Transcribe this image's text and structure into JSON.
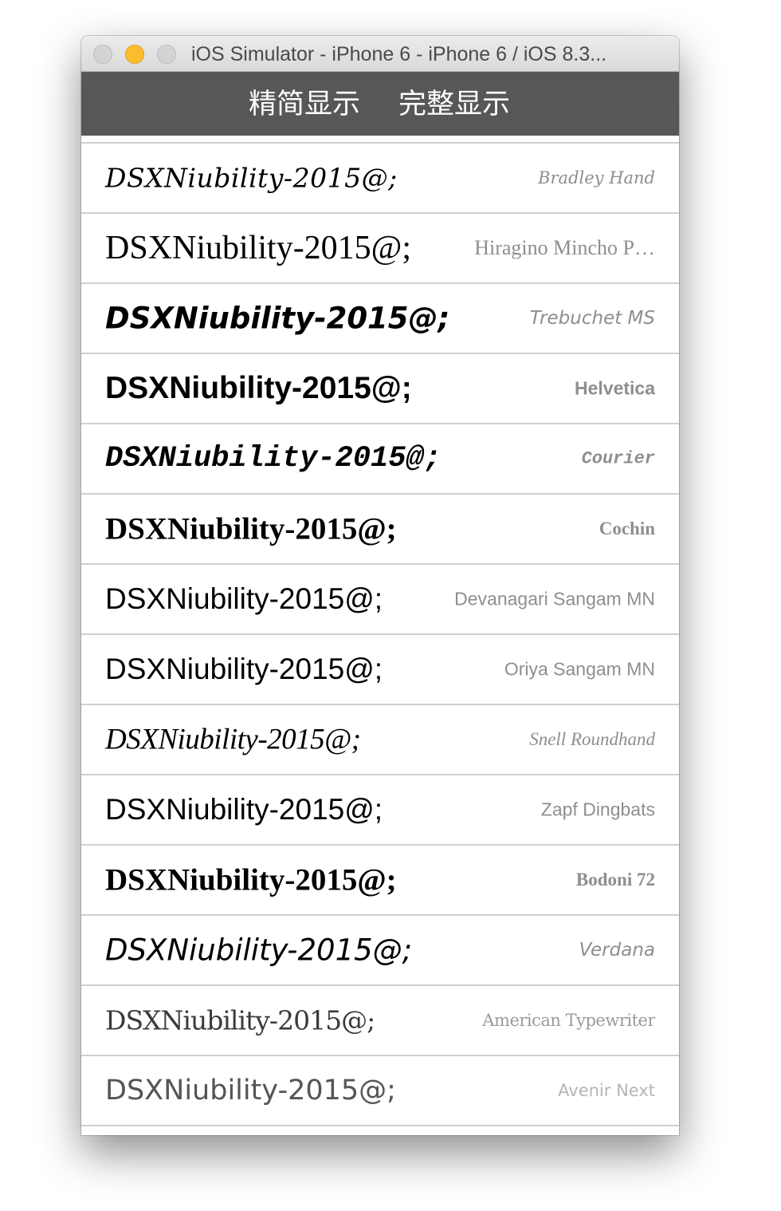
{
  "window": {
    "title": "iOS Simulator - iPhone 6 - iPhone 6 / iOS 8.3..."
  },
  "segmented": {
    "simple_label": "精简显示",
    "full_label": "完整显示"
  },
  "rows": [
    {
      "sample": "DSXNiubility-2015@;",
      "font_name": "Bradley Hand"
    },
    {
      "sample": "DSXNiubility-2015@;",
      "font_name": "Hiragino Mincho P…"
    },
    {
      "sample": "DSXNiubility-2015@;",
      "font_name": "Trebuchet MS"
    },
    {
      "sample": "DSXNiubility-2015@;",
      "font_name": "Helvetica"
    },
    {
      "sample": "DSXNiubility-2015@;",
      "font_name": "Courier"
    },
    {
      "sample": "DSXNiubility-2015@;",
      "font_name": "Cochin"
    },
    {
      "sample": "DSXNiubility-2015@;",
      "font_name": "Devanagari Sangam MN"
    },
    {
      "sample": "DSXNiubility-2015@;",
      "font_name": "Oriya Sangam MN"
    },
    {
      "sample": "DSXNiubility-2015@;",
      "font_name": "Snell Roundhand"
    },
    {
      "sample": "DSXNiubility-2015@;",
      "font_name": "Zapf Dingbats"
    },
    {
      "sample": "DSXNiubility-2015@;",
      "font_name": "Bodoni 72"
    },
    {
      "sample": "DSXNiubility-2015@;",
      "font_name": "Verdana"
    },
    {
      "sample": "DSXNiubility-2015@;",
      "font_name": "American Typewriter"
    },
    {
      "sample": "DSXNiubility-2015@;",
      "font_name": "Avenir Next"
    }
  ],
  "colors": {
    "navbar": "#575757",
    "traffic_minimize": "#fbbd2e",
    "separator": "#cfcfcf",
    "font_name_text": "#8e8e8e"
  }
}
